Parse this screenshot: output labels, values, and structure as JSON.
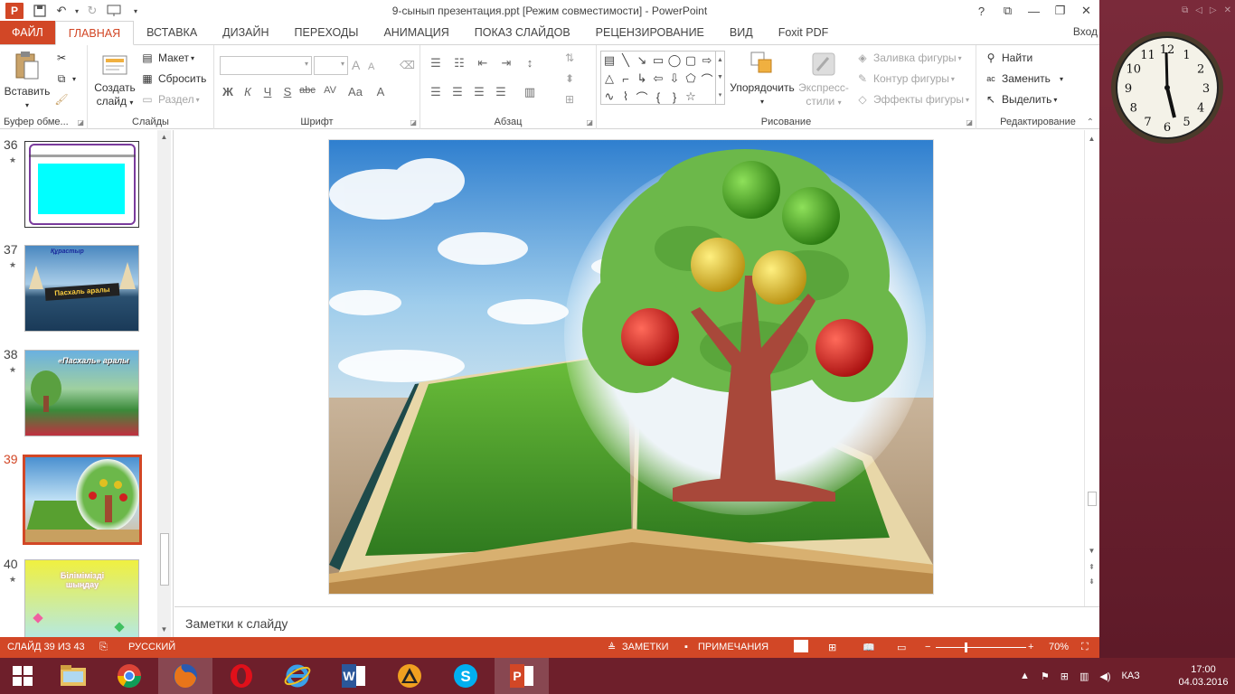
{
  "window": {
    "title": "9-сынып презентация.ppt [Режим совместимости] - PowerPoint",
    "help": "?",
    "signin": "Вход"
  },
  "tabs": [
    "ФАЙЛ",
    "ГЛАВНАЯ",
    "ВСТАВКА",
    "ДИЗАЙН",
    "ПЕРЕХОДЫ",
    "АНИМАЦИЯ",
    "ПОКАЗ СЛАЙДОВ",
    "РЕЦЕНЗИРОВАНИЕ",
    "ВИД",
    "Foxit PDF"
  ],
  "ribbon": {
    "clipboard": {
      "label": "Буфер обме...",
      "paste": "Вставить"
    },
    "slides": {
      "label": "Слайды",
      "new_slide_1": "Создать",
      "new_slide_2": "слайд",
      "layout": "Макет",
      "reset": "Сбросить",
      "section": "Раздел"
    },
    "font": {
      "label": "Шрифт",
      "bold": "Ж",
      "italic": "К",
      "underline": "Ч",
      "shadow": "S",
      "strike": "abc",
      "spacing": "AV",
      "case": "Aa",
      "color": "A",
      "grow": "A",
      "shrink": "A"
    },
    "paragraph": {
      "label": "Абзац"
    },
    "drawing": {
      "label": "Рисование",
      "arrange": "Упорядочить",
      "quick_styles_1": "Экспресс-",
      "quick_styles_2": "стили",
      "fill": "Заливка фигуры",
      "outline": "Контур фигуры",
      "effects": "Эффекты фигуры"
    },
    "editing": {
      "label": "Редактирование",
      "find": "Найти",
      "replace": "Заменить",
      "select": "Выделить"
    }
  },
  "slides": [
    {
      "num": "36",
      "current": false
    },
    {
      "num": "37",
      "current": false
    },
    {
      "num": "38",
      "current": false
    },
    {
      "num": "39",
      "current": true
    },
    {
      "num": "40",
      "current": false
    }
  ],
  "thumb_texts": {
    "t37_title": "Құрастыр",
    "t37_banner": "Пасхаль аралы",
    "t38_title": "«Пасхаль» аралы",
    "t40_text": "Білімімізді шыңдау"
  },
  "notes": {
    "placeholder": "Заметки к слайду"
  },
  "status": {
    "slide": "СЛАЙД 39 ИЗ 43",
    "language": "РУССКИЙ",
    "notes": "ЗАМЕТКИ",
    "comments": "ПРИМЕЧАНИЯ",
    "zoom": "70%"
  },
  "taskbar": {
    "lang": "КАЗ",
    "time": "17:00",
    "date": "04.03.2016"
  },
  "clock": {
    "numerals": [
      "12",
      "1",
      "2",
      "3",
      "4",
      "5",
      "6",
      "7",
      "8",
      "9",
      "10",
      "11"
    ]
  },
  "colors": {
    "accent": "#d24726",
    "taskbar": "#6e1f2b"
  }
}
